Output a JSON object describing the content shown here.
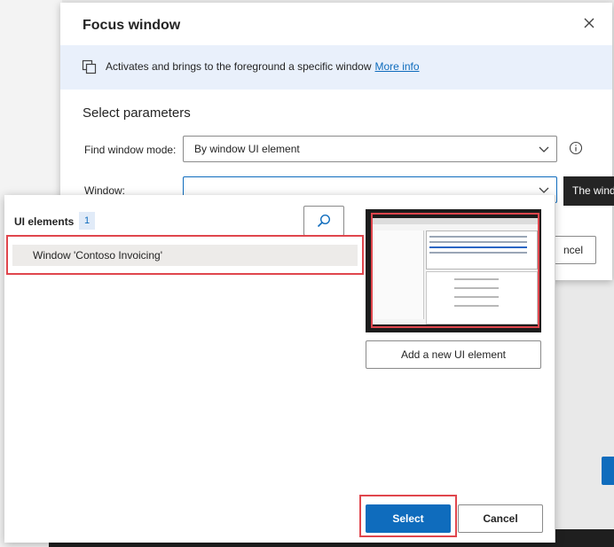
{
  "focus_dialog": {
    "title": "Focus window",
    "banner_text": "Activates and brings to the foreground a specific window",
    "banner_link": "More info",
    "section_title": "Select parameters",
    "find_mode_label": "Find window mode:",
    "find_mode_value": "By window UI element",
    "window_label": "Window:",
    "window_value": "",
    "tooltip_text": "The wind",
    "cancel_partial": "ncel"
  },
  "picker": {
    "heading": "UI elements",
    "count": "1",
    "items": [
      "Window 'Contoso Invoicing'"
    ],
    "add_button": "Add a new UI element",
    "select_button": "Select",
    "cancel_button": "Cancel"
  },
  "colors": {
    "accent": "#0f6cbd",
    "highlight_red": "#e0464d",
    "banner_bg": "#e9f0fb"
  }
}
